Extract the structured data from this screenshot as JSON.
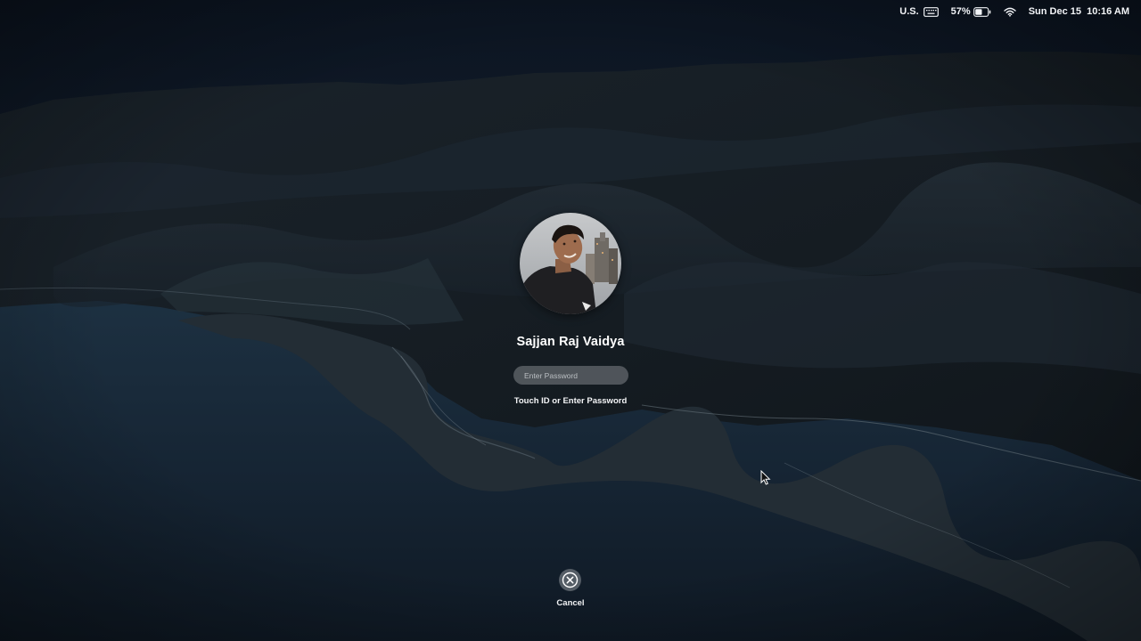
{
  "menubar": {
    "input_source": "U.S.",
    "keyboard_icon": "keyboard-icon",
    "battery_percent": "57%",
    "battery_level": 0.57,
    "battery_icon": "battery-icon",
    "wifi_icon": "wifi-icon",
    "datetime": "Sun Dec 15  10:16 AM"
  },
  "login": {
    "user_name": "Sajjan Raj Vaidya",
    "avatar_icon": "user-avatar",
    "password_placeholder": "Enter Password",
    "password_value": "",
    "hint": "Touch ID or Enter Password",
    "cancel_label": "Cancel",
    "cancel_icon": "close-circle-icon"
  },
  "cursor_icon": "pointer-cursor-icon",
  "colors": {
    "sky_top": "#0e1826",
    "sea": "#16222f",
    "mountain": "#141c22",
    "text": "#ffffff"
  }
}
